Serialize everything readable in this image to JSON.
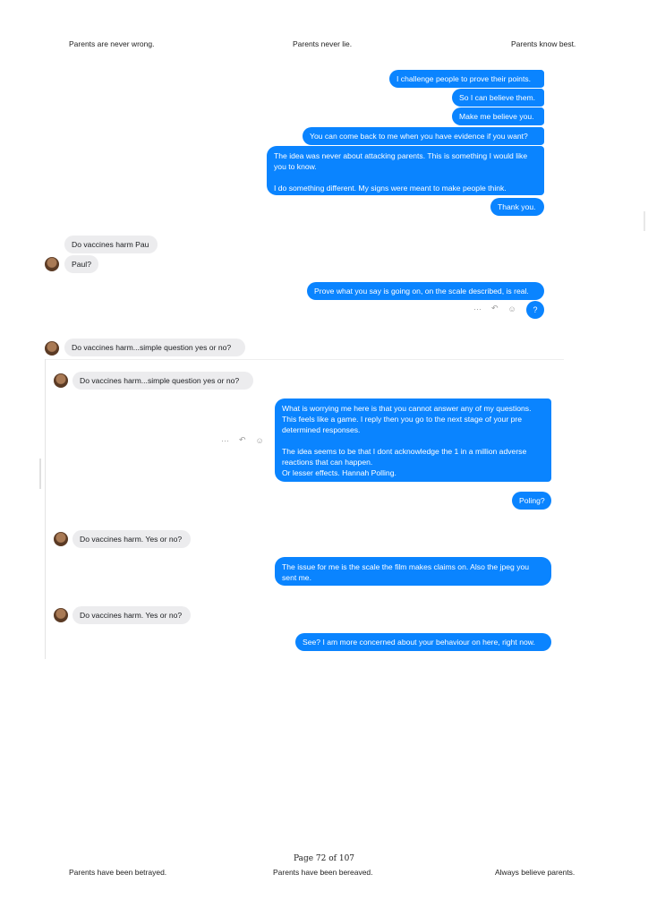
{
  "header": {
    "left": "Parents are never wrong.",
    "center": "Parents never lie.",
    "right": "Parents know best."
  },
  "footer": {
    "page": "Page 72 of 107",
    "left": "Parents have been betrayed.",
    "center": "Parents have been bereaved.",
    "right": "Always believe parents."
  },
  "chat": {
    "sent_1": "I challenge people to prove their points.",
    "sent_2": "So I can believe them.",
    "sent_3": "Make me believe you.",
    "sent_4": "You can come back to me when you have evidence if you want?",
    "sent_5": "The idea was never about attacking parents.  This is something I would like you to know.\n\nI do something different. My signs were meant to make people think.",
    "sent_6": "Thank you.",
    "recv_1": "Do vaccines harm Pau",
    "recv_2": "Paul?",
    "sent_7": "Prove what you say is going on, on the scale described, is real.",
    "sent_8": "?",
    "recv_3": "Do vaccines harm...simple question yes or no?",
    "recv_4": "Do vaccines harm...simple question yes or no?",
    "sent_9": "What is worrying me here is that you cannot answer any of my questions. This feels like a game. I reply then you go to the next stage of your pre determined responses.\n\nThe idea seems to be that I dont acknowledge the 1 in a million adverse reactions that can happen.\nOr lesser effects. Hannah Polling.",
    "sent_10": "Poling?",
    "recv_5": "Do vaccines harm. Yes or no?",
    "sent_11": "The issue for me is the scale the film makes claims on. Also the jpeg you sent me.",
    "recv_6": "Do vaccines harm. Yes or no?",
    "sent_12": "See? I am more concerned about your behaviour on here, right now."
  },
  "icons": {
    "more": "more-icon",
    "reply": "reply-icon",
    "react": "smiley-icon"
  },
  "colors": {
    "sent_bubble": "#0a84ff",
    "received_bubble": "#ececee"
  }
}
